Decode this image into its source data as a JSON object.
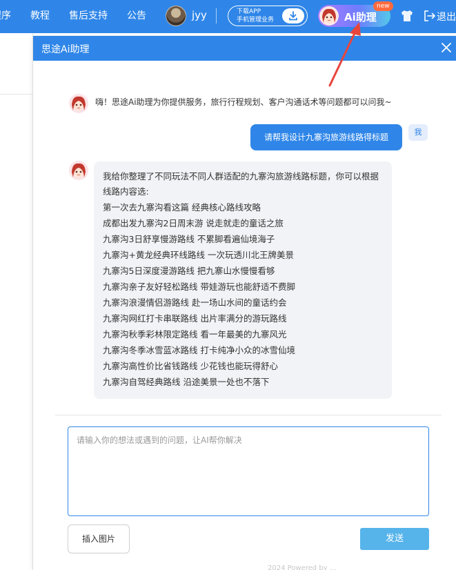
{
  "navbar": {
    "items": [
      "程序",
      "教程",
      "售后支持",
      "公告"
    ],
    "username": "jyy",
    "download_app": {
      "line1": "下载APP",
      "line2": "手机管理业务"
    },
    "ai_assistant_label": "Ai助理",
    "new_badge": "new",
    "logout_label": "退出"
  },
  "panel": {
    "title": "思途Ai助理",
    "greeting": "嗨！思途Ai助理为你提供服务，旅行行程规划、客户沟通话术等问题都可以问我~",
    "user_message": "请帮我设计九寨沟旅游线路得标题",
    "user_tag": "我",
    "answer_intro": "我给你整理了不同玩法不同人群适配的九寨沟旅游线路标题，你可以根据线路内容选:",
    "answer_lines": [
      "第一次去九寨沟看这篇 经典核心路线攻略",
      "成都出发九寨沟2日周末游 说走就走的童话之旅",
      "九寨沟3日舒享慢游路线 不累脚看遍仙境海子",
      "九寨沟+黄龙经典环线路线 一次玩透川北王牌美景",
      "九寨沟5日深度漫游路线 把九寨山水慢慢看够",
      "九寨沟亲子友好轻松路线 带娃游玩也能舒适不费脚",
      "九寨沟浪漫情侣游路线 赴一场山水间的童话约会",
      "九寨沟网红打卡串联路线 出片率满分的游玩路线",
      "九寨沟秋季彩林限定路线 看一年最美的九寨风光",
      "九寨沟冬季冰雪蓝冰路线 打卡纯净小众的冰雪仙境",
      "九寨沟高性价比省钱路线 少花钱也能玩得舒心",
      "九寨沟自驾经典路线 沿途美景一处也不落下"
    ],
    "input_placeholder": "请输入你的想法或遇到的问题，让AI帮你解决",
    "insert_image_label": "插入图片",
    "send_label": "发送",
    "footer_text": "2024 Powered by ..."
  },
  "colors": {
    "primary": "#2f86e8",
    "send_button": "#56b4ea",
    "answer_bg": "#f1f3f6",
    "arrow": "#e8453c"
  },
  "icons": [
    "user-avatar-icon",
    "download-icon",
    "ai-avatar-icon",
    "shirt-icon",
    "logout-icon",
    "close-icon"
  ]
}
